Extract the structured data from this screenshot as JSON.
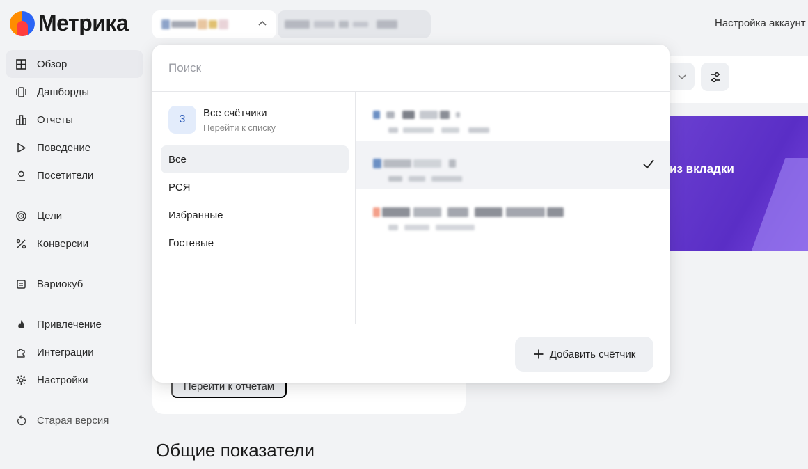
{
  "header": {
    "logo_text": "Метрика",
    "account_settings": "Настройка аккаунт"
  },
  "sidebar": {
    "items": [
      {
        "label": "Обзор",
        "icon": "grid-icon"
      },
      {
        "label": "Дашборды",
        "icon": "dashboard-icon"
      },
      {
        "label": "Отчеты",
        "icon": "bar-chart-icon"
      },
      {
        "label": "Поведение",
        "icon": "play-icon"
      },
      {
        "label": "Посетители",
        "icon": "person-icon"
      },
      {
        "label": "Цели",
        "icon": "target-icon"
      },
      {
        "label": "Конверсии",
        "icon": "percent-icon"
      },
      {
        "label": "Вариокуб",
        "icon": "cube-icon"
      },
      {
        "label": "Привлечение",
        "icon": "flame-icon"
      },
      {
        "label": "Интеграции",
        "icon": "puzzle-icon"
      },
      {
        "label": "Настройки",
        "icon": "gear-icon"
      },
      {
        "label": "Старая версия",
        "icon": "undo-icon"
      }
    ]
  },
  "popup": {
    "search_placeholder": "Поиск",
    "all_counters": {
      "count": "3",
      "title": "Все счётчики",
      "subtitle": "Перейти к списку"
    },
    "categories": [
      "Все",
      "РСЯ",
      "Избранные",
      "Гостевые"
    ],
    "add_counter_label": "Добавить счётчик"
  },
  "main": {
    "goto_reports": "Перейти к отчетам",
    "section_title": "Общие показатели",
    "promo_text": "из вкладки"
  },
  "colors": {
    "accent": "#2b64f5",
    "promo": "#5a2ec6",
    "background": "#f2f3f5"
  }
}
